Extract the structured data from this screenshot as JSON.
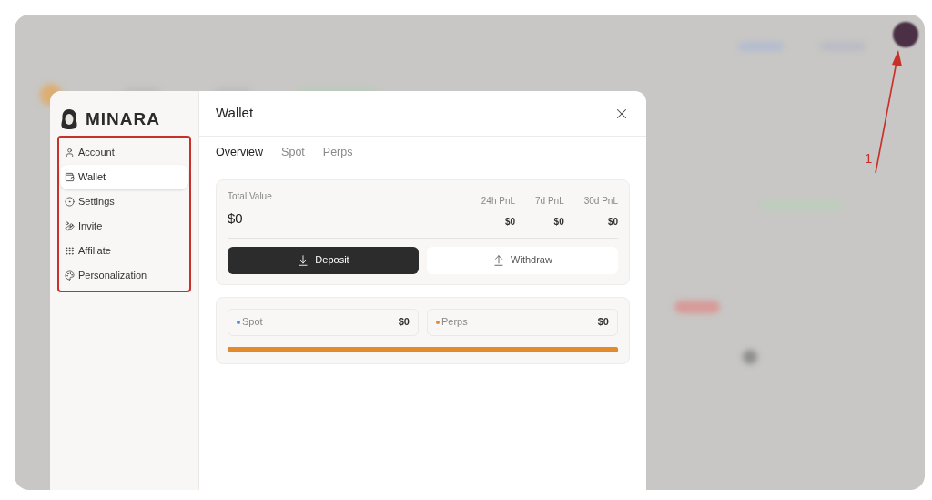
{
  "brand": {
    "name": "MINARA"
  },
  "sidebar": {
    "items": [
      {
        "label": "Account",
        "kind": "account",
        "selected": false
      },
      {
        "label": "Wallet",
        "kind": "wallet",
        "selected": true
      },
      {
        "label": "Settings",
        "kind": "settings",
        "selected": false
      },
      {
        "label": "Invite",
        "kind": "invite",
        "selected": false
      },
      {
        "label": "Affiliate",
        "kind": "affiliate",
        "selected": false
      },
      {
        "label": "Personalization",
        "kind": "palette",
        "selected": false
      }
    ]
  },
  "dialog": {
    "title": "Wallet"
  },
  "tabs": [
    {
      "label": "Overview",
      "selected": true
    },
    {
      "label": "Spot",
      "selected": false
    },
    {
      "label": "Perps",
      "selected": false
    }
  ],
  "summary": {
    "label": "Total Value",
    "value": "$0",
    "pnl": [
      {
        "label": "24h PnL",
        "value": "$0"
      },
      {
        "label": "7d PnL",
        "value": "$0"
      },
      {
        "label": "30d PnL",
        "value": "$0"
      }
    ]
  },
  "actions": [
    {
      "label": "Deposit",
      "kind": "deposit"
    },
    {
      "label": "Withdraw",
      "kind": "withdraw"
    }
  ],
  "balances": [
    {
      "label": "Spot",
      "value": "$0",
      "color": "#4a90f0"
    },
    {
      "label": "Perps",
      "value": "$0",
      "color": "#e38a2c"
    }
  ],
  "allocation": {
    "level": 1
  },
  "annotation": {
    "label": "1"
  }
}
